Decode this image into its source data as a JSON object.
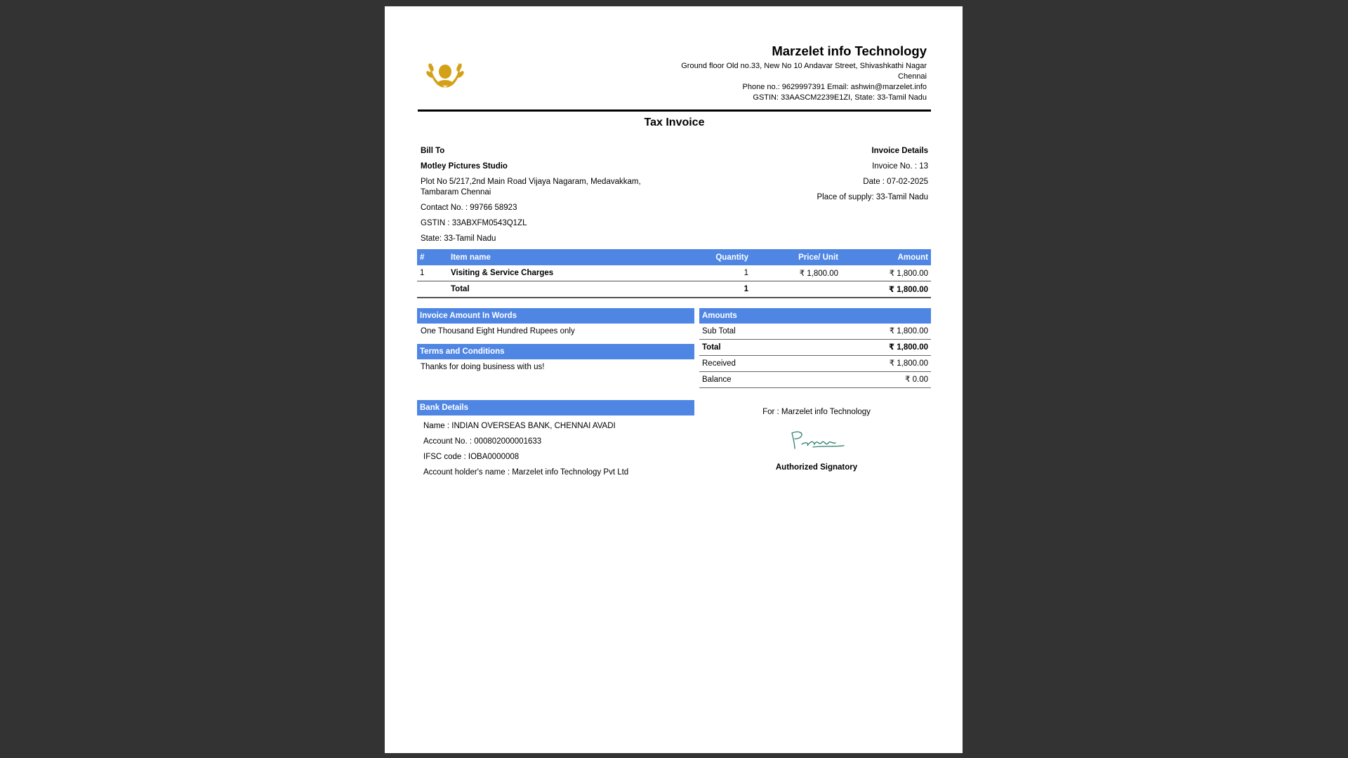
{
  "company": {
    "name": "Marzelet info Technology",
    "address_line1": "Ground floor Old no.33, New No 10 Andavar Street, Shivashkathi Nagar",
    "address_line2": "Chennai",
    "contact": "Phone no.: 9629997391 Email: ashwin@marzelet.info",
    "gst": "GSTIN: 33AASCM2239E1ZI, State: 33-Tamil Nadu"
  },
  "title": "Tax Invoice",
  "bill_to": {
    "heading": "Bill To",
    "customer": "Motley Pictures Studio",
    "address": "Plot No 5/217,2nd Main Road Vijaya Nagaram, Medavakkam, Tambaram Chennai",
    "contact": "Contact No. : 99766 58923",
    "gstin": "GSTIN : 33ABXFM0543Q1ZL",
    "state": "State: 33-Tamil Nadu"
  },
  "invoice_details": {
    "heading": "Invoice Details",
    "number": "Invoice No. : 13",
    "date": "Date : 07-02-2025",
    "place": "Place of supply: 33-Tamil Nadu"
  },
  "items_table": {
    "headers": [
      "#",
      "Item name",
      "Quantity",
      "Price/ Unit",
      "Amount"
    ],
    "rows": [
      {
        "no": "1",
        "name": "Visiting & Service Charges",
        "qty": "1",
        "price": "₹ 1,800.00",
        "amount": "₹ 1,800.00"
      }
    ],
    "total": {
      "label": "Total",
      "qty": "1",
      "amount": "₹ 1,800.00"
    }
  },
  "amount_words": {
    "heading": "Invoice Amount In Words",
    "text": "One Thousand Eight Hundred Rupees only"
  },
  "terms": {
    "heading": "Terms and Conditions",
    "text": "Thanks for doing business with us!"
  },
  "amounts": {
    "heading": "Amounts",
    "rows": [
      {
        "label": "Sub Total",
        "value": "₹ 1,800.00"
      },
      {
        "label": "Total",
        "value": "₹ 1,800.00"
      },
      {
        "label": "Received",
        "value": "₹ 1,800.00"
      },
      {
        "label": "Balance",
        "value": "₹ 0.00"
      }
    ]
  },
  "bank": {
    "heading": "Bank Details",
    "name": "Name : INDIAN OVERSEAS BANK, CHENNAI AVADI",
    "account": "Account No. : 000802000001633",
    "ifsc": "IFSC code : IOBA0000008",
    "holder": "Account holder's name : Marzelet info Technology Pvt Ltd"
  },
  "signatory": {
    "for": "For : Marzelet info Technology",
    "label": "Authorized Signatory"
  },
  "colors": {
    "accent": "#4f86e4",
    "background": "#333333",
    "logo_gold": "#d4a017",
    "signature": "#2e7d6b"
  }
}
